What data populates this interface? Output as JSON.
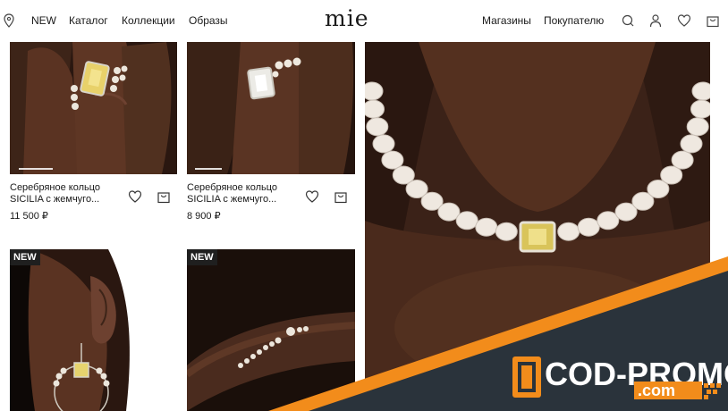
{
  "header": {
    "nav_left": [
      "NEW",
      "Каталог",
      "Коллекции",
      "Образы"
    ],
    "logo": "mie",
    "nav_right": [
      "Магазины",
      "Покупателю"
    ]
  },
  "products": [
    {
      "name_line1": "Серебряное кольцо",
      "name_line2": "SICILIA с жемчуго...",
      "price": "11 500 ₽"
    },
    {
      "name_line1": "Серебряное кольцо",
      "name_line2": "SICILIA с жемчуго...",
      "price": "8 900 ₽"
    }
  ],
  "badges": [
    "NEW",
    "NEW"
  ],
  "promo": {
    "main": "COD-PROMO",
    "sub": ".com"
  },
  "colors": {
    "accent_orange": "#f28c1b",
    "promo_dark": "#2a333b",
    "skin": "#4a2b1e"
  }
}
